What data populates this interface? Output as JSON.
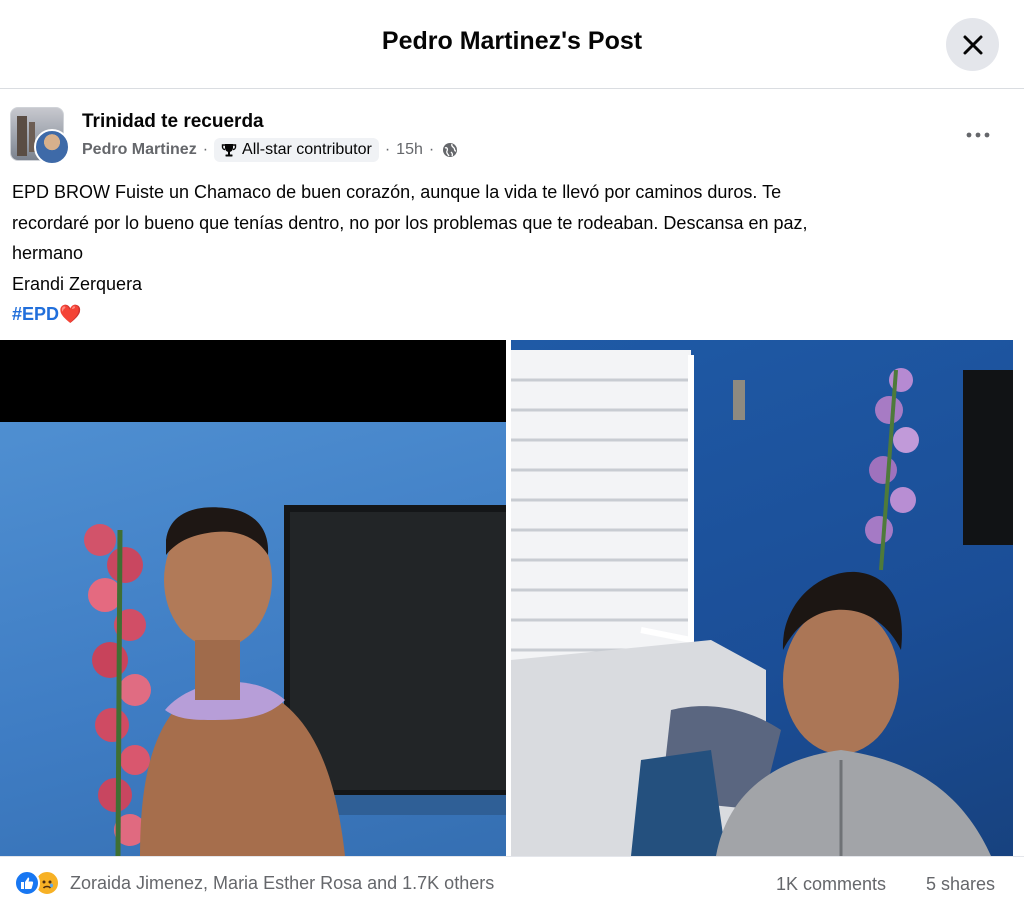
{
  "modal": {
    "title": "Pedro Martinez's Post",
    "close_icon": "close-icon"
  },
  "post": {
    "group_name": "Trinidad te recuerda",
    "author": "Pedro Martinez",
    "badge": "All-star contributor",
    "badge_icon": "trophy-icon",
    "time": "15h",
    "audience_icon": "globe-icon",
    "more_icon": "more-options-icon",
    "text_lines": [
      "EPD BROW Fuiste un Chamaco de buen corazón, aunque la vida te llevó por caminos duros. Te",
      "recordaré por lo bueno que tenías dentro, no por los problemas que te rodeaban. Descansa en paz,",
      "hermano",
      "Erandi Zerquera"
    ],
    "hashtag": "#EPD",
    "hashtag_emoji": "❤️"
  },
  "photos": [
    {
      "name": "photo-left",
      "icon": "photo"
    },
    {
      "name": "photo-right",
      "icon": "photo"
    }
  ],
  "footer": {
    "reactions_text": "Zoraida Jimenez, Maria Esther Rosa and 1.7K others",
    "reaction_icons": [
      "like-reaction-icon",
      "sad-reaction-icon"
    ],
    "comments": "1K comments",
    "shares": "5 shares"
  },
  "colors": {
    "hashtag": "#216fdb",
    "like": "#1877f2",
    "sad": "#f7b125",
    "secondary_text": "#65676b"
  }
}
